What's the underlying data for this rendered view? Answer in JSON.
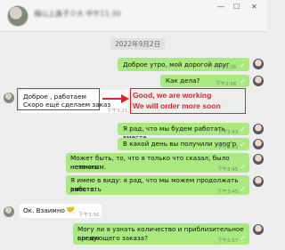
{
  "header": {
    "contact_name": "福山上鑫子少大 中午11:30",
    "minimize": "—",
    "maximize": "☐",
    "close": "✕"
  },
  "date_divider": "2022年9月2日",
  "messages": [
    {
      "side": "right",
      "text": "Доброе утро, мой дорогой друг",
      "time": "下午2:26"
    },
    {
      "side": "right",
      "text": "Как дела?",
      "time": "下午2:56"
    },
    {
      "side": "left",
      "text_lines": [
        "Доброе , работаем",
        "Скоро ещё сделаем заказ"
      ],
      "time": "下午3:21"
    },
    {
      "side": "right",
      "text": "Я рад, что мы будем работать вместе",
      "time": "下午3:43"
    },
    {
      "side": "right",
      "text": "В какой день вы получили yang'p",
      "time": "下午3:43"
    },
    {
      "side": "right",
      "text_lines": [
        "Может быть, то, что я только что сказал, было немного",
        "неточным."
      ],
      "time": "下午3:45"
    },
    {
      "side": "right",
      "text_lines": [
        "Я имею в виду: я рад, что мы можем продолжать работать",
        "вместе."
      ],
      "time": "下午3:45"
    },
    {
      "side": "left",
      "text": "Ок. Взаимно",
      "emoji": "🤝",
      "time": "下午3:56"
    },
    {
      "side": "right",
      "text_lines": [
        "Могу ли я узнать количество и приблизительное время",
        "следующего заказа?"
      ],
      "time": "下午3:57"
    }
  ],
  "annotation": {
    "line1": "Good, we are working",
    "line2": "We will order more soon",
    "color": "#d42a2a"
  }
}
